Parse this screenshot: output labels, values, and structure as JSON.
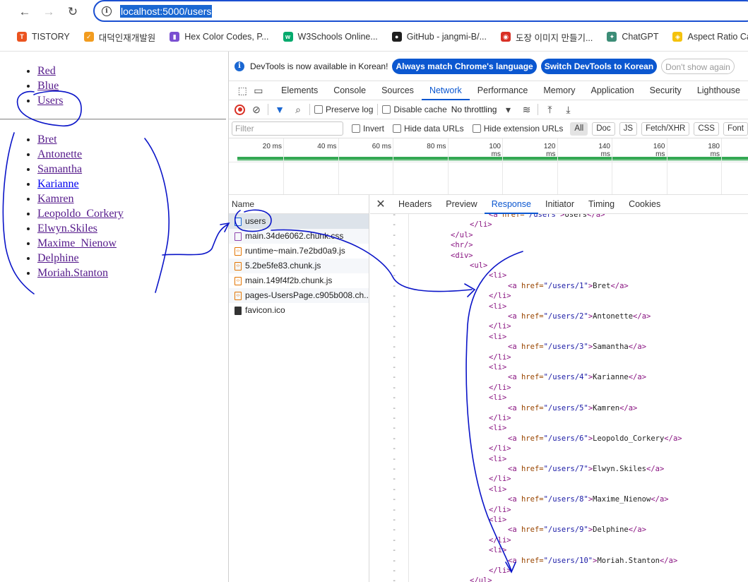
{
  "browser": {
    "url": "localhost:5000/users",
    "bookmarks": [
      {
        "label": "TISTORY",
        "color": "#eb531f",
        "glyph": "T"
      },
      {
        "label": "대덕인재개발원",
        "color": "#f29c1f",
        "glyph": "✓"
      },
      {
        "label": "Hex Color Codes, P...",
        "color": "#7a4fd1",
        "glyph": "▮"
      },
      {
        "label": "W3Schools Online...",
        "color": "#04aa6d",
        "glyph": "w"
      },
      {
        "label": "GitHub - jangmi-B/...",
        "color": "#1f1f1f",
        "glyph": "●"
      },
      {
        "label": "도장 이미지 만들기...",
        "color": "#d93025",
        "glyph": "◉"
      },
      {
        "label": "ChatGPT",
        "color": "#3c8d77",
        "glyph": "✦"
      },
      {
        "label": "Aspect Ratio Ca",
        "color": "#f4c20d",
        "glyph": "◈"
      }
    ]
  },
  "page": {
    "nav_links": [
      "Red",
      "Blue",
      "Users"
    ],
    "users": [
      "Bret",
      "Antonette",
      "Samantha",
      "Karianne",
      "Kamren",
      "Leopoldo_Corkery",
      "Elwyn.Skiles",
      "Maxime_Nienow",
      "Delphine",
      "Moriah.Stanton"
    ]
  },
  "devtools": {
    "notice_text": "DevTools is now available in Korean!",
    "notice_btn_match": "Always match Chrome's language",
    "notice_btn_switch": "Switch DevTools to Korean",
    "notice_btn_dismiss": "Don't show again",
    "tabs": [
      "Elements",
      "Console",
      "Sources",
      "Network",
      "Performance",
      "Memory",
      "Application",
      "Security",
      "Lighthouse"
    ],
    "active_tab": "Network",
    "preserve_log": "Preserve log",
    "disable_cache": "Disable cache",
    "throttling": "No throttling",
    "filter_placeholder": "Filter",
    "invert": "Invert",
    "hide_data_urls": "Hide data URLs",
    "hide_extension_urls": "Hide extension URLs",
    "type_filters": [
      "All",
      "Doc",
      "JS",
      "Fetch/XHR",
      "CSS",
      "Font"
    ],
    "timeline_labels": [
      "20 ms",
      "40 ms",
      "60 ms",
      "80 ms",
      "100 ms",
      "120 ms",
      "140 ms",
      "160 ms",
      "180 ms"
    ],
    "name_header": "Name",
    "requests": [
      {
        "name": "users",
        "type": "doc"
      },
      {
        "name": "main.34de6062.chunk.css",
        "type": "css"
      },
      {
        "name": "runtime~main.7e2bd0a9.js",
        "type": "js"
      },
      {
        "name": "5.2be5fe83.chunk.js",
        "type": "js"
      },
      {
        "name": "main.149f4f2b.chunk.js",
        "type": "js"
      },
      {
        "name": "pages-UsersPage.c905b008.ch...",
        "type": "js"
      },
      {
        "name": "favicon.ico",
        "type": "ico"
      }
    ],
    "detail_tabs": [
      "Headers",
      "Preview",
      "Response",
      "Initiator",
      "Timing",
      "Cookies"
    ],
    "active_detail_tab": "Response",
    "response_lines": [
      {
        "indent": 4,
        "html": "<a href=\"/users\">Users</a>"
      },
      {
        "indent": 3,
        "html": "</li>"
      },
      {
        "indent": 2,
        "html": "</ul>"
      },
      {
        "indent": 2,
        "html": "<hr/>"
      },
      {
        "indent": 2,
        "html": "<div>"
      },
      {
        "indent": 3,
        "html": "<ul>"
      },
      {
        "indent": 4,
        "html": "<li>"
      },
      {
        "indent": 5,
        "html": "<a href=\"/users/1\">Bret</a>"
      },
      {
        "indent": 4,
        "html": "</li>"
      },
      {
        "indent": 4,
        "html": "<li>"
      },
      {
        "indent": 5,
        "html": "<a href=\"/users/2\">Antonette</a>"
      },
      {
        "indent": 4,
        "html": "</li>"
      },
      {
        "indent": 4,
        "html": "<li>"
      },
      {
        "indent": 5,
        "html": "<a href=\"/users/3\">Samantha</a>"
      },
      {
        "indent": 4,
        "html": "</li>"
      },
      {
        "indent": 4,
        "html": "<li>"
      },
      {
        "indent": 5,
        "html": "<a href=\"/users/4\">Karianne</a>"
      },
      {
        "indent": 4,
        "html": "</li>"
      },
      {
        "indent": 4,
        "html": "<li>"
      },
      {
        "indent": 5,
        "html": "<a href=\"/users/5\">Kamren</a>"
      },
      {
        "indent": 4,
        "html": "</li>"
      },
      {
        "indent": 4,
        "html": "<li>"
      },
      {
        "indent": 5,
        "html": "<a href=\"/users/6\">Leopoldo_Corkery</a>"
      },
      {
        "indent": 4,
        "html": "</li>"
      },
      {
        "indent": 4,
        "html": "<li>"
      },
      {
        "indent": 5,
        "html": "<a href=\"/users/7\">Elwyn.Skiles</a>"
      },
      {
        "indent": 4,
        "html": "</li>"
      },
      {
        "indent": 4,
        "html": "<li>"
      },
      {
        "indent": 5,
        "html": "<a href=\"/users/8\">Maxime_Nienow</a>"
      },
      {
        "indent": 4,
        "html": "</li>"
      },
      {
        "indent": 4,
        "html": "<li>"
      },
      {
        "indent": 5,
        "html": "<a href=\"/users/9\">Delphine</a>"
      },
      {
        "indent": 4,
        "html": "</li>"
      },
      {
        "indent": 4,
        "html": "<li>"
      },
      {
        "indent": 5,
        "html": "<a href=\"/users/10\">Moriah.Stanton</a>"
      },
      {
        "indent": 4,
        "html": "</li>"
      },
      {
        "indent": 3,
        "html": "</ul>"
      }
    ]
  },
  "colors": {
    "accent": "#0b57d0",
    "annotation_ink": "#0a14c8",
    "timeline_bar": "#34a853"
  }
}
